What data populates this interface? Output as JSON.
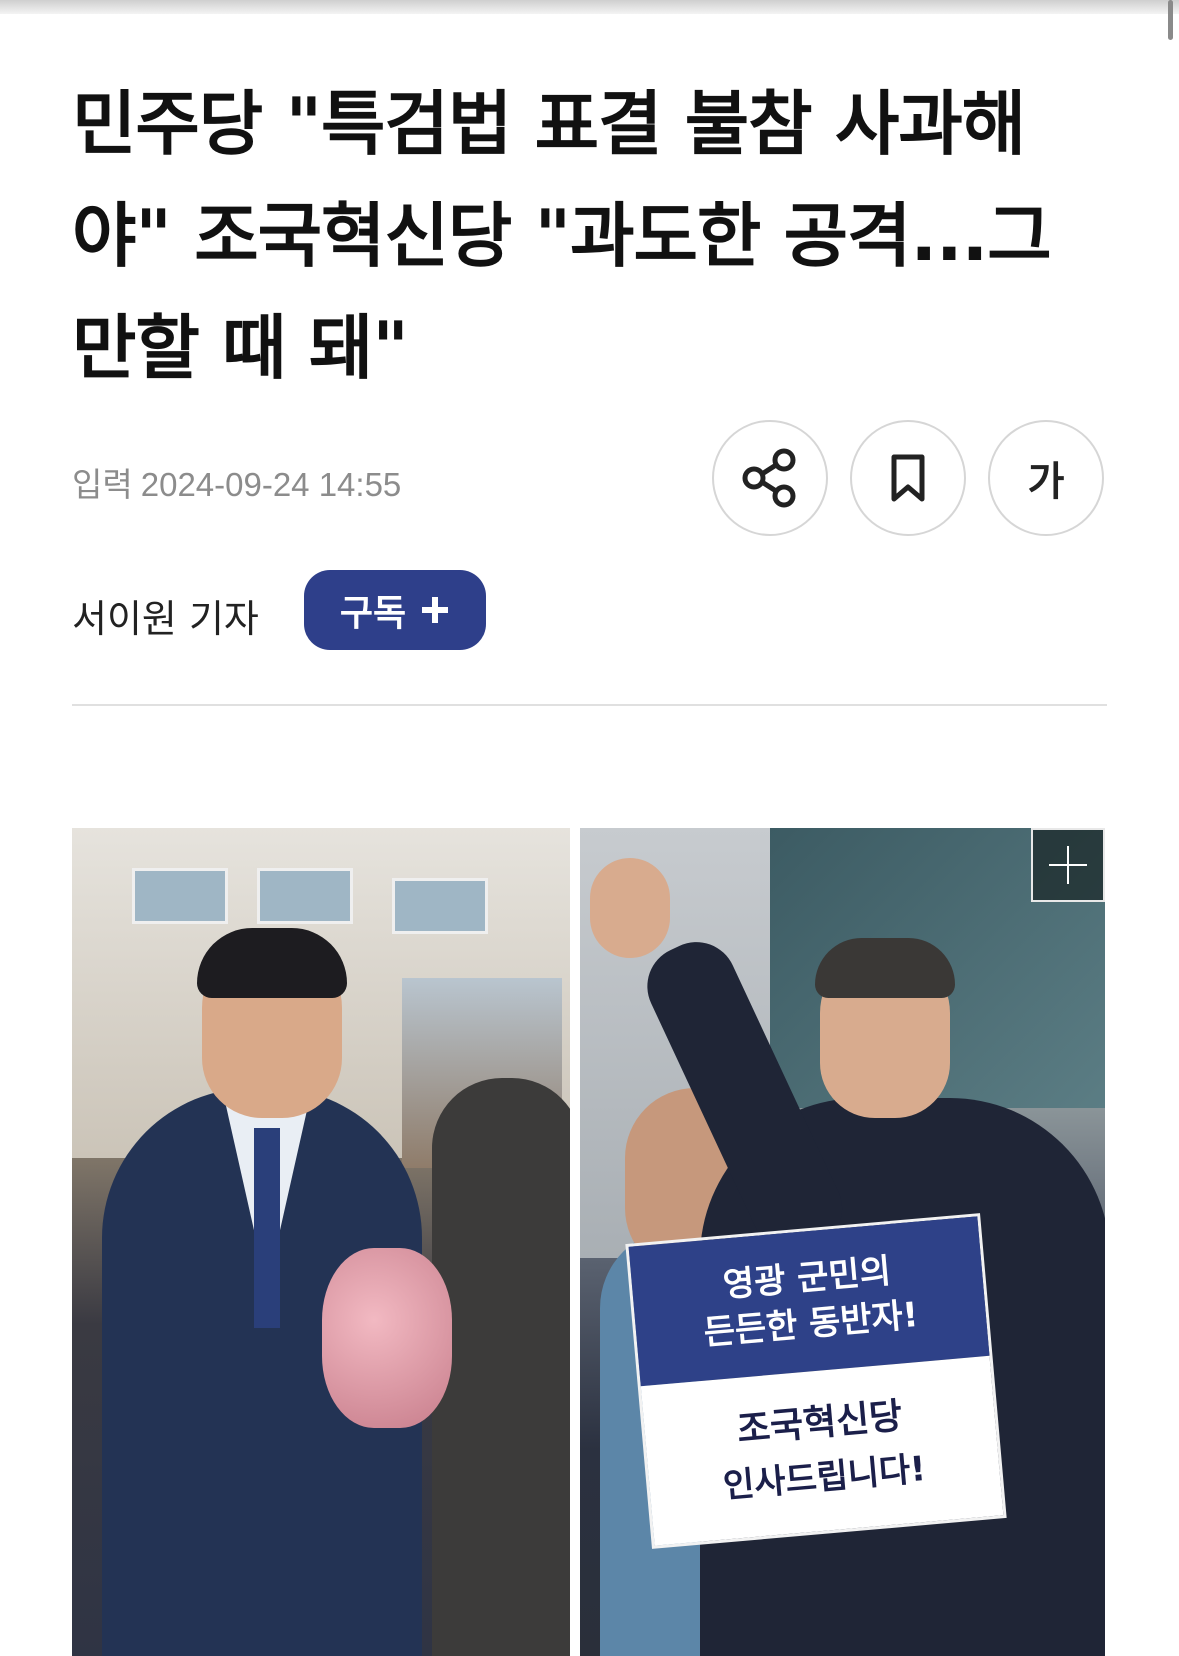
{
  "article": {
    "title": "민주당 \"특검법 표결 불참 사과해야\" 조국혁신당 \"과도한 공격...그만할 때 돼\"",
    "published_label": "입력",
    "published_time": "2024-09-24 14:55",
    "reporter": "서이원 기자",
    "subscribe_label": "구독",
    "subscribe_icon": "plus-icon"
  },
  "actions": {
    "share_icon": "share-icon",
    "bookmark_icon": "bookmark-icon",
    "font_size_label": "가"
  },
  "photo": {
    "expand_icon": "plus-icon",
    "placard": {
      "top_line1": "영광 군민의",
      "top_line2": "든든한 동반자!",
      "bottom_line1": "조국혁신당",
      "bottom_line2": "인사드립니다!"
    }
  },
  "colors": {
    "subscribe_bg": "#2e3f8a",
    "placard_blue": "#2e4188",
    "meta_text": "#8c8c8c"
  }
}
